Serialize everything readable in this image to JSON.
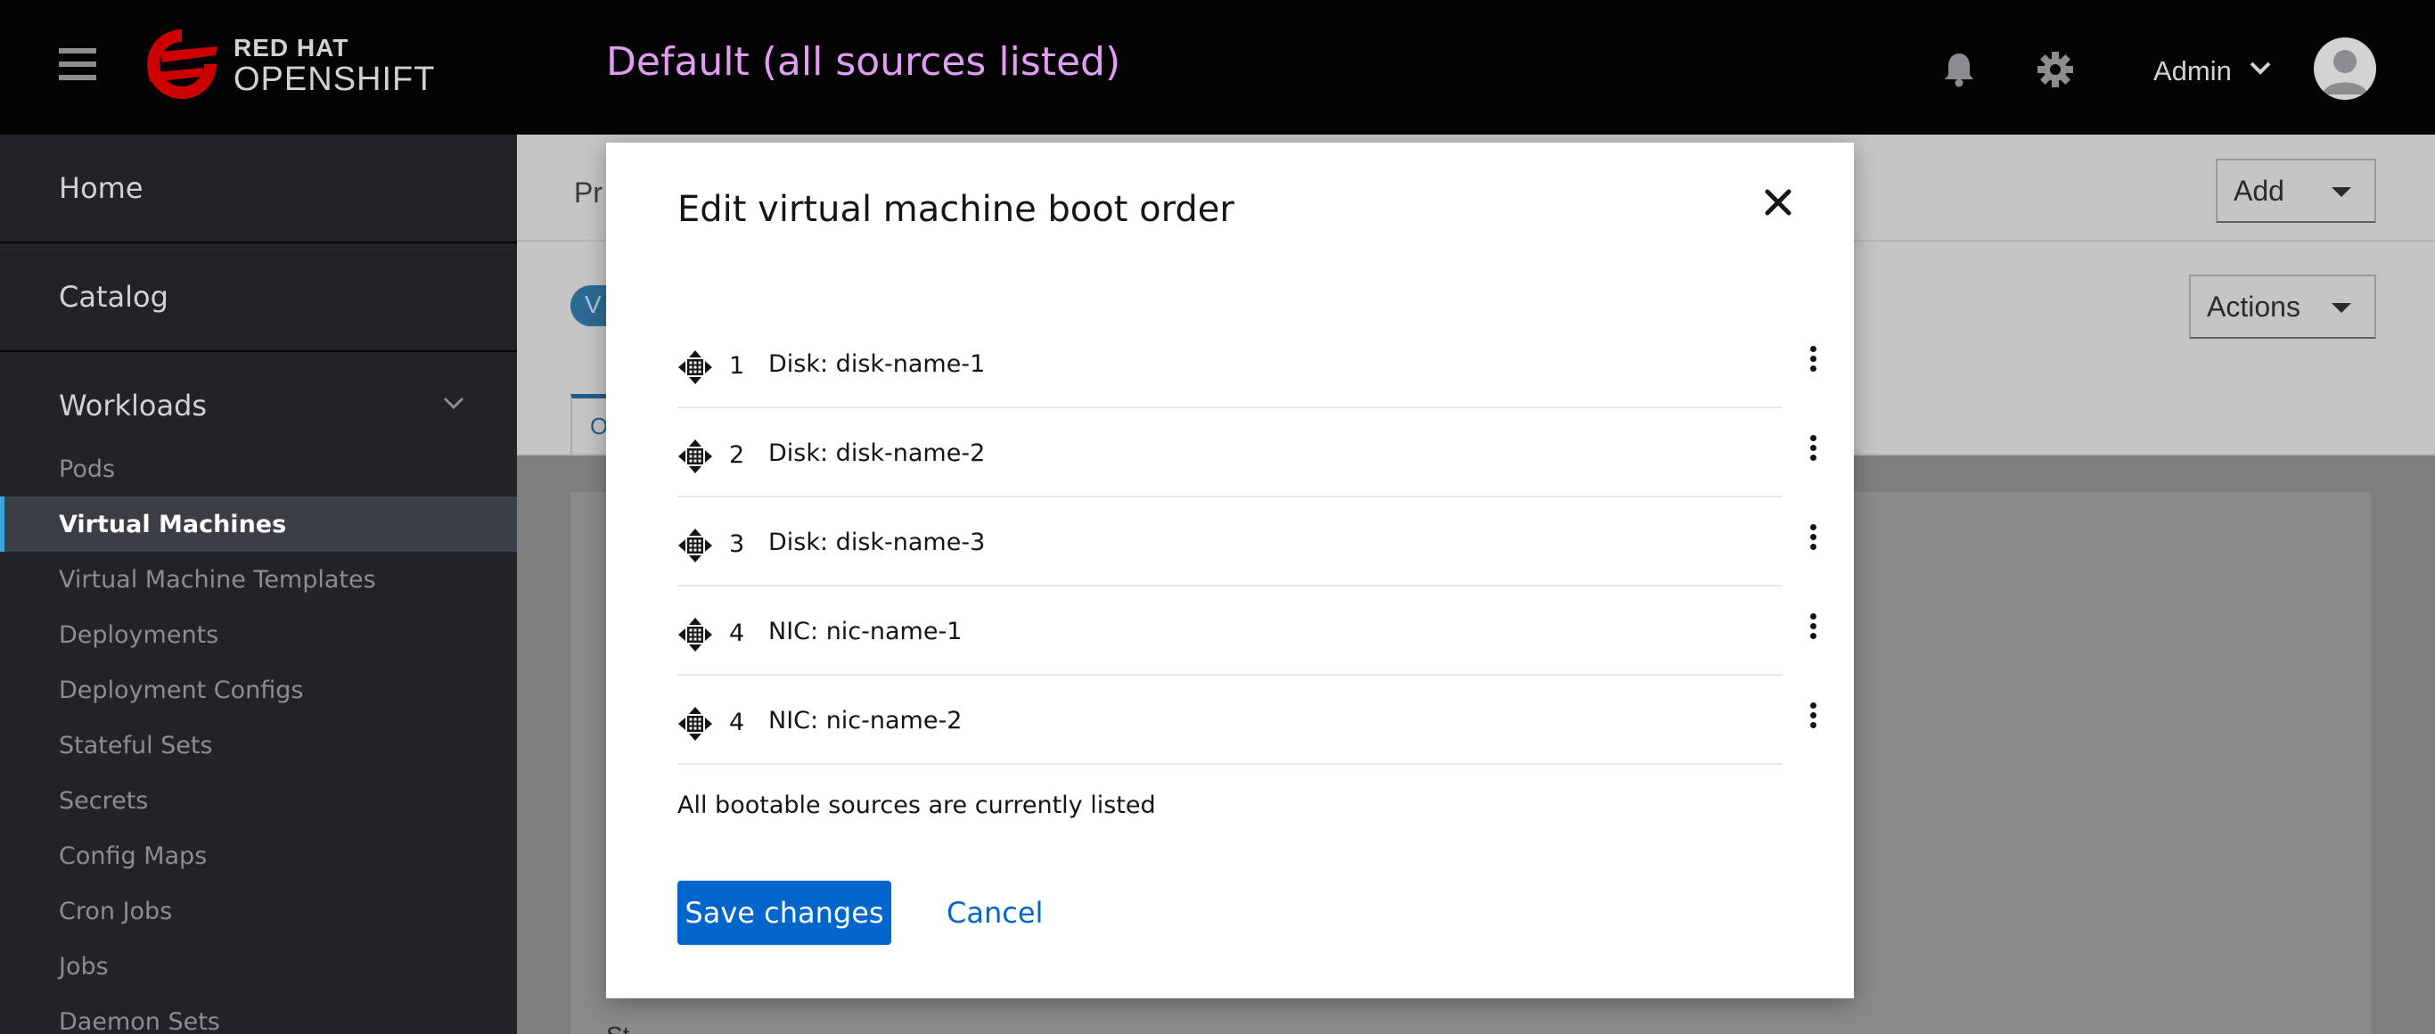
{
  "masthead": {
    "brand_line1": "RED HAT",
    "brand_line2": "OPENSHIFT",
    "title": "Default (all sources listed)",
    "user_name": "Admin"
  },
  "sidebar": {
    "top_items": [
      {
        "label": "Home"
      },
      {
        "label": "Catalog"
      },
      {
        "label": "Workloads"
      }
    ],
    "workload_items": [
      {
        "label": "Pods",
        "active": false
      },
      {
        "label": "Virtual Machines",
        "active": true
      },
      {
        "label": "Virtual Machine Templates",
        "active": false
      },
      {
        "label": "Deployments",
        "active": false
      },
      {
        "label": "Deployment Configs",
        "active": false
      },
      {
        "label": "Stateful Sets",
        "active": false
      },
      {
        "label": "Secrets",
        "active": false
      },
      {
        "label": "Config Maps",
        "active": false
      },
      {
        "label": "Cron Jobs",
        "active": false
      },
      {
        "label": "Jobs",
        "active": false
      },
      {
        "label": "Daemon Sets",
        "active": false
      }
    ]
  },
  "background": {
    "page_prefix": "Pr",
    "pill_prefix": "V",
    "tab_prefix": "O",
    "add_label": "Add",
    "actions_label": "Actions",
    "status_prefix": "St"
  },
  "modal": {
    "title": "Edit virtual machine boot order",
    "boot_items": [
      {
        "order": "1",
        "label": "Disk: disk-name-1"
      },
      {
        "order": "2",
        "label": "Disk: disk-name-2"
      },
      {
        "order": "3",
        "label": "Disk: disk-name-3"
      },
      {
        "order": "4",
        "label": "NIC: nic-name-1"
      },
      {
        "order": "4",
        "label": "NIC: nic-name-2"
      }
    ],
    "note": "All bootable sources are currently listed",
    "save_label": "Save changes",
    "cancel_label": "Cancel"
  },
  "colors": {
    "masthead_bg": "#030303",
    "title_accent": "#e29cf5",
    "primary": "#0066cc",
    "sidebar_bg": "#212427",
    "active_marker": "#39a5dc"
  }
}
